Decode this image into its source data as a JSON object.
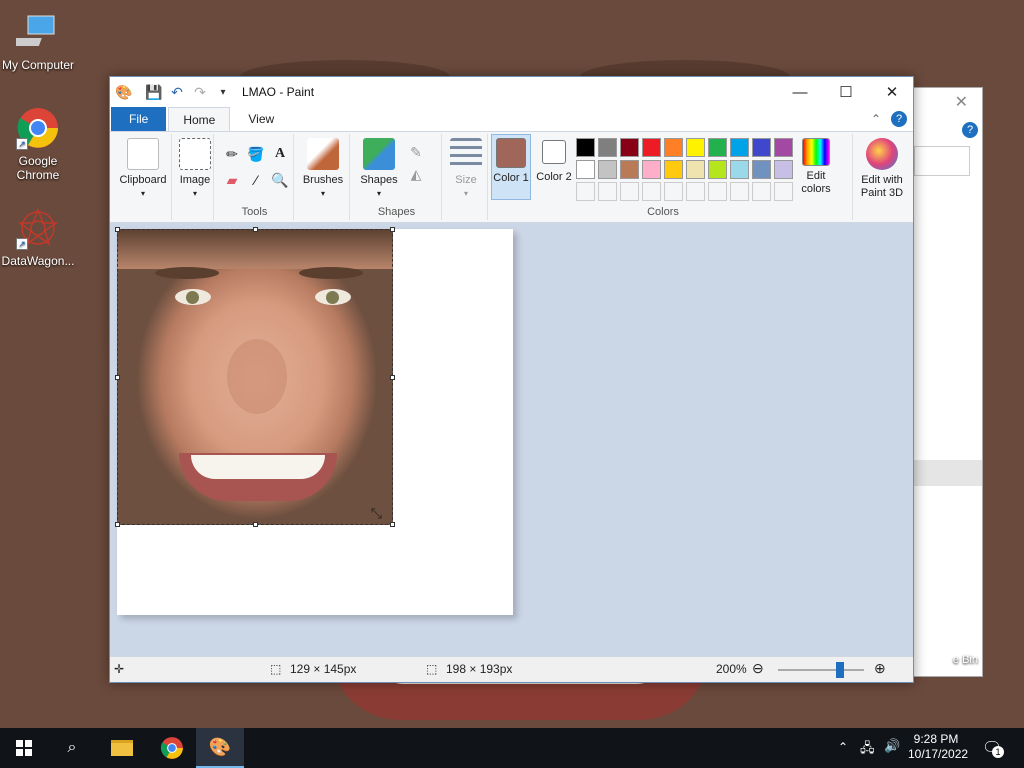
{
  "desktop": {
    "icons": [
      {
        "label": "My Computer"
      },
      {
        "label": "Google Chrome"
      },
      {
        "label": "DataWagon..."
      }
    ],
    "back_window_text": "e Bin"
  },
  "paint": {
    "title": "LMAO - Paint",
    "tabs": {
      "file": "File",
      "home": "Home",
      "view": "View"
    },
    "groups": {
      "clipboard": "Clipboard",
      "image": "Image",
      "tools": "Tools",
      "brushes": "Brushes",
      "shapes": "Shapes",
      "shapes_group": "Shapes",
      "size": "Size",
      "color1": "Color 1",
      "color2": "Color 2",
      "edit_colors": "Edit colors",
      "paint3d": "Edit with Paint 3D",
      "colors_group": "Colors"
    },
    "active_colors": {
      "color1": "#a0665a",
      "color2": "#ffffff"
    },
    "palette": [
      "#000000",
      "#7f7f7f",
      "#880015",
      "#ed1c24",
      "#ff7f27",
      "#fff200",
      "#22b14c",
      "#00a2e8",
      "#3f48cc",
      "#a349a4",
      "#ffffff",
      "#c3c3c3",
      "#b97a57",
      "#ffaec9",
      "#ffc90e",
      "#efe4b0",
      "#b5e61d",
      "#99d9ea",
      "#7092be",
      "#c8bfe7"
    ],
    "status": {
      "selection_size": "129 × 145px",
      "image_size": "198 × 193px",
      "zoom": "200%",
      "zoom_level": 0.72
    }
  },
  "taskbar": {
    "time": "9:28 PM",
    "date": "10/17/2022",
    "notification_count": "1"
  }
}
